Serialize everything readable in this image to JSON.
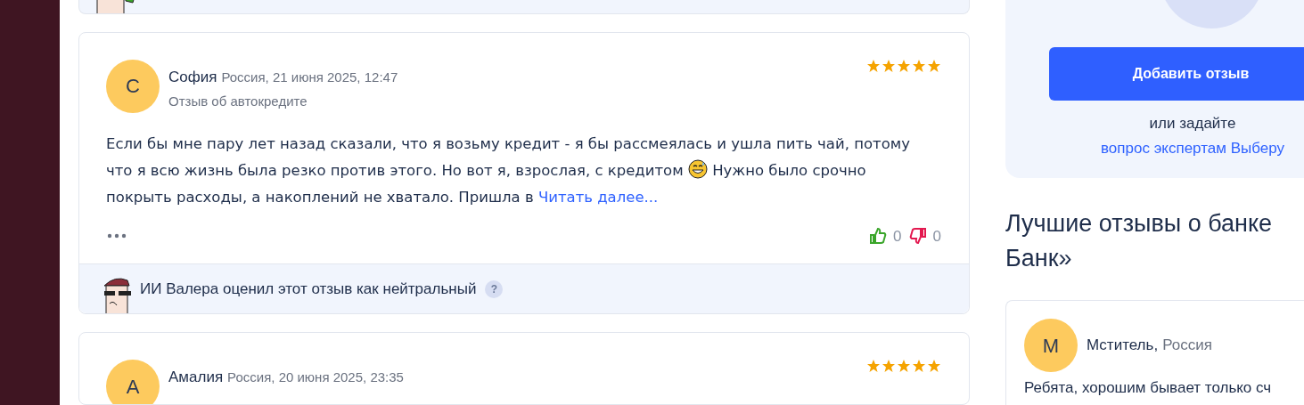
{
  "reviews": [
    {
      "avatar_letter": "С",
      "name": "София",
      "meta": "Россия, 21 июня 2025, 12:47",
      "subject": "Отзыв об автокредите",
      "stars": 5,
      "text_before": "Если бы мне пару лет назад сказали, что я возьму кредит - я бы рассмеялась и ушла пить чай, потому что я всю жизнь была резко против этого. Но вот я, взрослая, с кредитом",
      "text_after": "Нужно было срочно покрыть расходы, а накоплений не хватало. Пришла в",
      "read_more": "Читать далее...",
      "likes": "0",
      "dislikes": "0",
      "ai_verdict": "ИИ Валера оценил этот отзыв как нейтральный",
      "help": "?"
    },
    {
      "avatar_letter": "А",
      "name": "Амалия",
      "meta": "Россия, 20 июня 2025, 23:35",
      "stars": 5
    }
  ],
  "sidebar": {
    "add_button": "Добавить отзыв",
    "or_ask": "или задайте",
    "experts_link": "вопрос экспертам Выберу",
    "best_title": "Лучшие отзывы о банке",
    "best_title_cont": "Банк»",
    "best_review": {
      "avatar_letter": "М",
      "name": "Мститель,",
      "region": "Россия",
      "text": "Ребята, хорошим бывает только сч"
    }
  }
}
